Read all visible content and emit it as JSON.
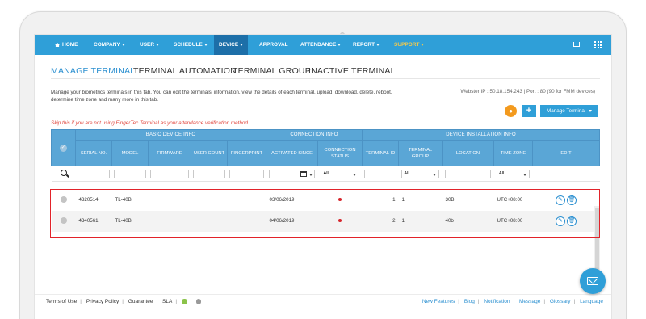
{
  "nav": {
    "home": "HOME",
    "company": "COMPANY",
    "user": "USER",
    "schedule": "SCHEDULE",
    "device": "DEVICE",
    "approval": "APPROVAL",
    "attendance": "ATTENDANCE",
    "report": "REPORT",
    "support": "SUPPORT",
    "icons": [
      "cart-icon",
      "apps-grid-icon"
    ]
  },
  "tabs": [
    "MANAGE TERMINAL",
    "TERMINAL AUTOMATION",
    "TERMINAL GROUP",
    "INACTIVE TERMINAL"
  ],
  "description": "Manage your biometrics terminals in this tab. You can edit the terminals' information, view the details of each terminal, upload, download, delete, reboot, determine time zone and many more in this tab.",
  "webster": "Webster IP : 50.18.154.243 | Port : 80 (90 for FMM devices)",
  "actions": {
    "add": "+",
    "manage": "Manage Terminal"
  },
  "skip_note": "Skip this if you are not using FingerTec Terminal as your attendance verification method.",
  "table": {
    "groups": [
      "BASIC DEVICE INFO",
      "CONNECTION INFO",
      "DEVICE INSTALLATION INFO"
    ],
    "columns": [
      "SERIAL NO.",
      "MODEL",
      "FIRMWARE",
      "USER COUNT",
      "FINGERPRINT",
      "ACTIVATED SINCE",
      "CONNECTION STATUS",
      "TERMINAL ID",
      "TERMINAL GROUP",
      "LOCATION",
      "TIME ZONE",
      "EDIT"
    ],
    "filters": {
      "status": "All",
      "group": "All",
      "timezone": "All"
    },
    "rows": [
      {
        "serial": "4320514",
        "model": "TL-40B",
        "firmware": "",
        "user_count": "",
        "fingerprint": "",
        "activated": "03/06/2019",
        "terminal_id": "1",
        "group": "1",
        "location": "30B",
        "timezone": "UTC+08:00"
      },
      {
        "serial": "4340561",
        "model": "TL-40B",
        "firmware": "",
        "user_count": "",
        "fingerprint": "",
        "activated": "04/06/2019",
        "terminal_id": "2",
        "group": "1",
        "location": "40b",
        "timezone": "UTC+08:00"
      }
    ]
  },
  "footer": {
    "left": [
      "Terms of Use",
      "Privacy Policy",
      "Guarantee",
      "SLA"
    ],
    "right": [
      "New Features",
      "Blog",
      "Notification",
      "Message",
      "Glossary",
      "Language"
    ]
  },
  "colors": {
    "primary": "#2f9fd8",
    "nav_active": "#1d6fa8",
    "support": "#f3c94c",
    "alert": "#e0453c",
    "highlight": "#e2232a"
  }
}
